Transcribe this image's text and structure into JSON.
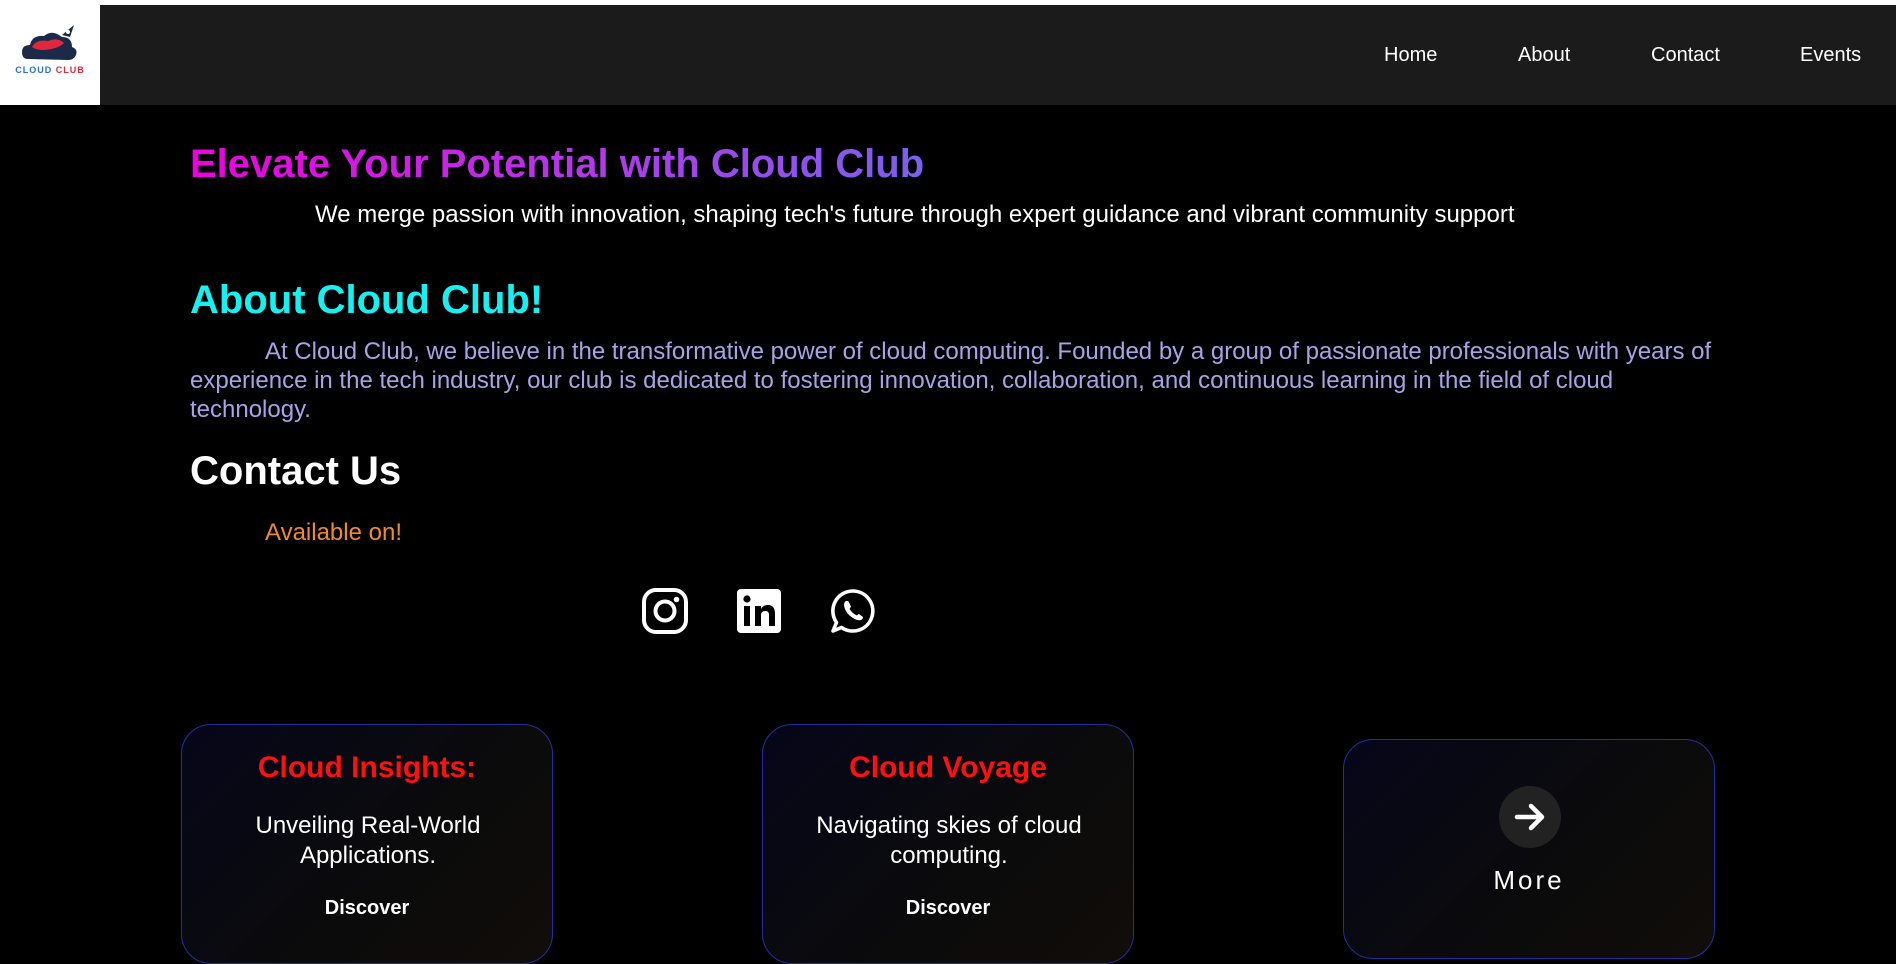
{
  "navbar": {
    "logo": {
      "text_part1": "CLOUD",
      "text_part2": "CLUB"
    },
    "links": [
      "Home",
      "About",
      "Contact",
      "Events"
    ]
  },
  "hero": {
    "title": "Elevate Your Potential with Cloud Club",
    "subtitle": "We merge passion with innovation, shaping tech's future through expert guidance and vibrant community support"
  },
  "about": {
    "title": "About Cloud Club!",
    "text": "At Cloud Club, we believe in the transformative power of cloud computing. Founded by a group of passionate professionals with years of experience in the tech industry, our club is dedicated to fostering innovation, collaboration, and continuous learning in the field of cloud technology."
  },
  "contact": {
    "title": "Contact Us",
    "available": "Available on!",
    "socials": [
      "instagram-icon",
      "linkedin-icon",
      "whatsapp-icon"
    ]
  },
  "cards": [
    {
      "title": "Cloud Insights:",
      "description": "Unveiling Real-World Applications.",
      "link": "Discover"
    },
    {
      "title": "Cloud Voyage",
      "description": "Navigating skies of cloud computing.",
      "link": "Discover"
    },
    {
      "label": "More",
      "icon": "arrow-right-icon"
    }
  ],
  "colors": {
    "hero_gradient": [
      "#ee00e0",
      "#7a60ee"
    ],
    "about_title": "#16f0f0",
    "about_text": "#a8a3e8",
    "available": "#f08a2a",
    "card_title": "#ff1010",
    "card_border": "#2c2a9a"
  }
}
